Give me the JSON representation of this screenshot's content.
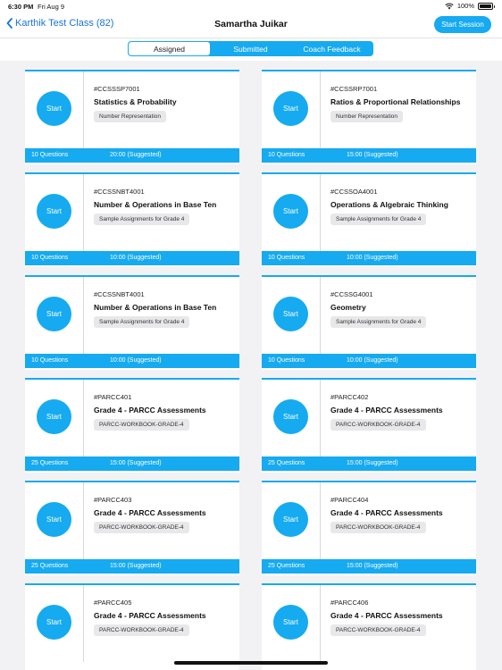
{
  "status_bar": {
    "time": "6:30 PM",
    "date": "Fri Aug 9",
    "battery": "100%",
    "icons": [
      "wifi-icon",
      "battery-icon"
    ]
  },
  "nav": {
    "back_label": "Karthik Test Class (82)",
    "title": "Samartha Juikar",
    "start_session_label": "Start Session"
  },
  "tabs": [
    {
      "label": "Assigned",
      "active": true
    },
    {
      "label": "Submitted",
      "active": false
    },
    {
      "label": "Coach Feedback",
      "active": false
    }
  ],
  "colors": {
    "accent": "#16aaf0",
    "link": "#1a73d9",
    "background": "#f2f2f4",
    "tag_bg": "#e8e8ea"
  },
  "start_label": "Start",
  "cards": [
    {
      "code": "#CCSSSP7001",
      "title": "Statistics & Probability",
      "tag": "Number Representation",
      "questions": "10 Questions",
      "time": "20:00 (Suggested)"
    },
    {
      "code": "#CCSSRP7001",
      "title": "Ratios & Proportional Relationships",
      "tag": "Number Representation",
      "questions": "10 Questions",
      "time": "15:00 (Suggested)"
    },
    {
      "code": "#CCSSNBT4001",
      "title": "Number & Operations in Base Ten",
      "tag": "Sample Assignments for Grade 4",
      "questions": "10 Questions",
      "time": "10:00 (Suggested)"
    },
    {
      "code": "#CCSSOA4001",
      "title": "Operations & Algebraic Thinking",
      "tag": "Sample Assignments for Grade 4",
      "questions": "10 Questions",
      "time": "10:00 (Suggested)"
    },
    {
      "code": "#CCSSNBT4001",
      "title": "Number & Operations in Base Ten",
      "tag": "Sample Assignments for Grade 4",
      "questions": "10 Questions",
      "time": "10:00 (Suggested)"
    },
    {
      "code": "#CCSSG4001",
      "title": "Geometry",
      "tag": "Sample Assignments for Grade 4",
      "questions": "10 Questions",
      "time": "10:00 (Suggested)"
    },
    {
      "code": "#PARCC401",
      "title": "Grade 4 - PARCC Assessments",
      "tag": "PARCC-WORKBOOK-GRADE-4",
      "questions": "25 Questions",
      "time": "15:00 (Suggested)"
    },
    {
      "code": "#PARCC402",
      "title": "Grade 4 - PARCC Assessments",
      "tag": "PARCC-WORKBOOK-GRADE-4",
      "questions": "25 Questions",
      "time": "15:00 (Suggested)"
    },
    {
      "code": "#PARCC403",
      "title": "Grade 4 - PARCC Assessments",
      "tag": "PARCC-WORKBOOK-GRADE-4",
      "questions": "25 Questions",
      "time": "15:00 (Suggested)"
    },
    {
      "code": "#PARCC404",
      "title": "Grade 4 - PARCC Assessments",
      "tag": "PARCC-WORKBOOK-GRADE-4",
      "questions": "25 Questions",
      "time": "15:00 (Suggested)"
    },
    {
      "code": "#PARCC405",
      "title": "Grade 4 - PARCC Assessments",
      "tag": "PARCC-WORKBOOK-GRADE-4",
      "questions": "",
      "time": ""
    },
    {
      "code": "#PARCC406",
      "title": "Grade 4 - PARCC Assessments",
      "tag": "PARCC-WORKBOOK-GRADE-4",
      "questions": "",
      "time": ""
    }
  ]
}
